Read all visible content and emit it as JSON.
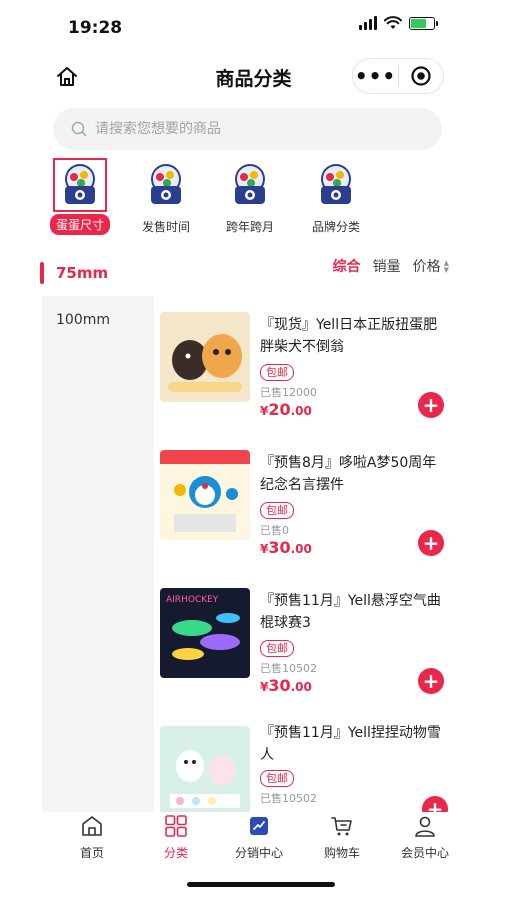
{
  "status": {
    "time": "19:28"
  },
  "nav": {
    "title": "商品分类",
    "more": "•••"
  },
  "search": {
    "placeholder": "请搜索您想要的商品"
  },
  "categories": [
    {
      "label": "蛋蛋尺寸",
      "active": true
    },
    {
      "label": "发售时间",
      "active": false
    },
    {
      "label": "跨年跨月",
      "active": false
    },
    {
      "label": "品牌分类",
      "active": false
    }
  ],
  "size_filter": {
    "active": "75mm",
    "items": [
      "100mm"
    ]
  },
  "sort": {
    "comprehensive": "综合",
    "sales": "销量",
    "price": "价格"
  },
  "products": [
    {
      "name": "『现货』Yell日本正版扭蛋肥胖柴犬不倒翁",
      "tag": "包邮",
      "sold": "已售12000",
      "price_prefix": "¥",
      "price_int": "20",
      "price_dec": ".00"
    },
    {
      "name": "『预售8月』哆啦A梦50周年纪念名言摆件",
      "tag": "包邮",
      "sold": "已售0",
      "price_prefix": "¥",
      "price_int": "30",
      "price_dec": ".00"
    },
    {
      "name": "『预售11月』Yell悬浮空气曲棍球赛3",
      "tag": "包邮",
      "sold": "已售10502",
      "price_prefix": "¥",
      "price_int": "30",
      "price_dec": ".00"
    },
    {
      "name": "『预售11月』Yell捏捏动物雪人",
      "tag": "包邮",
      "sold": "已售10502",
      "price_prefix": "¥",
      "price_int": "",
      "price_dec": ""
    }
  ],
  "tabbar": [
    {
      "label": "首页",
      "icon": "home-icon"
    },
    {
      "label": "分类",
      "icon": "grid-icon"
    },
    {
      "label": "分销中心",
      "icon": "chart-icon"
    },
    {
      "label": "购物车",
      "icon": "cart-icon"
    },
    {
      "label": "会员中心",
      "icon": "user-icon"
    }
  ],
  "colors": {
    "accent": "#e8274a",
    "capsule_blue": "#2c3f8f"
  }
}
